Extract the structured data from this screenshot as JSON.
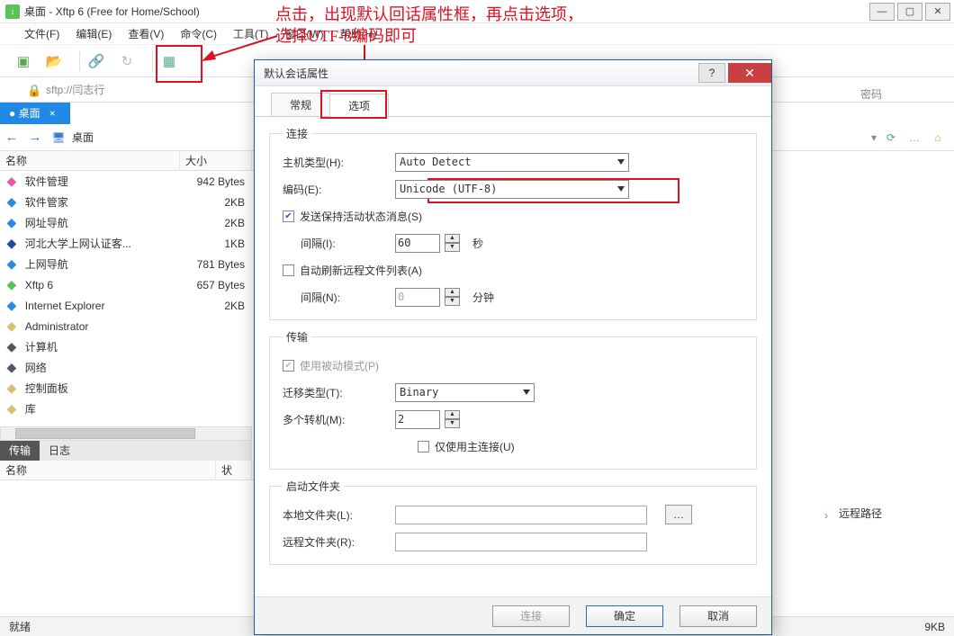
{
  "window": {
    "title": "桌面 - Xftp 6 (Free for Home/School)"
  },
  "menu": [
    "文件(F)",
    "编辑(E)",
    "查看(V)",
    "命令(C)",
    "工具(T)",
    "窗口(W)",
    "帮助(H)"
  ],
  "annotation": {
    "line1": "点击，出现默认回话属性框，再点击选项，",
    "line2": "选择UTF-8编码即可"
  },
  "addr": {
    "value": "sftp://闫志行"
  },
  "password_label": "密码",
  "sidebar_tab": "桌面",
  "nav_label": "桌面",
  "list_headers": {
    "name": "名称",
    "size": "大小"
  },
  "files": [
    {
      "name": "软件管理",
      "size": "942 Bytes",
      "iconColor": "#e65aa8"
    },
    {
      "name": "软件管家",
      "size": "2KB",
      "iconColor": "#2a89e0"
    },
    {
      "name": "网址导航",
      "size": "2KB",
      "iconColor": "#2a89e0"
    },
    {
      "name": "河北大学上网认证客...",
      "size": "1KB",
      "iconColor": "#1c4ea5"
    },
    {
      "name": "上网导航",
      "size": "781 Bytes",
      "iconColor": "#2a89e0"
    },
    {
      "name": "Xftp 6",
      "size": "657 Bytes",
      "iconColor": "#5ac35a"
    },
    {
      "name": "Internet Explorer",
      "size": "2KB",
      "iconColor": "#2a89e0"
    },
    {
      "name": "Administrator",
      "size": "",
      "iconColor": "#d8c070"
    },
    {
      "name": "计算机",
      "size": "",
      "iconColor": "#556"
    },
    {
      "name": "网络",
      "size": "",
      "iconColor": "#556"
    },
    {
      "name": "控制面板",
      "size": "",
      "iconColor": "#d8c070"
    },
    {
      "name": "库",
      "size": "",
      "iconColor": "#d8c070"
    }
  ],
  "log_tabs": {
    "transfer": "传输",
    "log": "日志"
  },
  "log_headers": {
    "name": "名称",
    "status": "状"
  },
  "status": {
    "left": "就绪",
    "right": "9KB"
  },
  "remote": "远程路径",
  "dialog": {
    "title": "默认会话属性",
    "tab_general": "常规",
    "tab_options": "选项",
    "group_conn": "连接",
    "host_type_label": "主机类型(H):",
    "host_type_value": "Auto Detect",
    "encoding_label": "编码(E):",
    "encoding_value": "Unicode (UTF-8)",
    "send_keepalive": "发送保持活动状态消息(S)",
    "interval_label": "间隔(I):",
    "interval_value": "60",
    "seconds": "秒",
    "auto_refresh": "自动刷新远程文件列表(A)",
    "interval_n_label": "间隔(N):",
    "interval_n_value": "0",
    "minutes": "分钟",
    "group_transfer": "传输",
    "passive_mode": "使用被动模式(P)",
    "transfer_type_label": "迁移类型(T):",
    "transfer_type_value": "Binary",
    "multi_conn_label": "多个转机(M):",
    "multi_conn_value": "2",
    "only_primary": "仅使用主连接(U)",
    "group_startup": "启动文件夹",
    "local_folder_label": "本地文件夹(L):",
    "remote_folder_label": "远程文件夹(R):",
    "btn_connect": "连接",
    "btn_ok": "确定",
    "btn_cancel": "取消"
  }
}
